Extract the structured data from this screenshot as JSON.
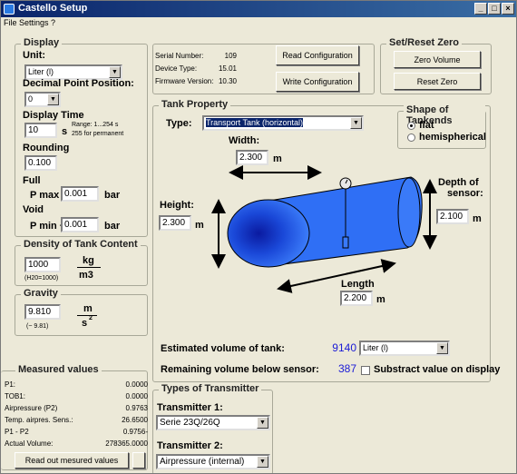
{
  "window": {
    "title": "Castello Setup",
    "min": "_",
    "max": "□",
    "close": "×"
  },
  "menu": [
    "File",
    "Settings",
    "?"
  ],
  "display": {
    "group": "Display",
    "unit_label": "Unit:",
    "unit_value": "Liter (l)",
    "dp_label": "Decimal Point Position:",
    "dp_value": "0",
    "time_label": "Display Time",
    "time_value": "10",
    "time_unit": "s",
    "time_range": "Range: 1...254 s",
    "time_perm": "255 for permanent",
    "rounding_label": "Rounding",
    "rounding_value": "0.100",
    "full_label": "Full",
    "pmax_label": "P max -",
    "pmax_value": "0.001",
    "pmax_unit": "bar",
    "void_label": "Void",
    "pmin_label": "P min +",
    "pmin_value": "0.001",
    "pmin_unit": "bar"
  },
  "density": {
    "group": "Density of Tank Content",
    "value": "1000",
    "unit_num": "kg",
    "unit_den": "m3",
    "note": "(H20=1000)"
  },
  "gravity": {
    "group": "Gravity",
    "value": "9.810",
    "unit_num": "m",
    "unit_den": "s",
    "unit_exp": "2",
    "note": "(~ 9.81)"
  },
  "device": {
    "serial_label": "Serial Number:",
    "serial_value": "109",
    "type_label": "Device Type:",
    "type_value": "15.01",
    "fw_label": "Firmware Version:",
    "fw_value": "10.30",
    "read_btn": "Read Configuration",
    "write_btn": "Write Configuration"
  },
  "zero": {
    "group": "Set/Reset Zero",
    "zero_btn": "Zero Volume",
    "reset_btn": "Reset Zero"
  },
  "tank": {
    "group": "Tank Property",
    "type_label": "Type:",
    "type_value": "Transport Tank (horizontal)",
    "width_label": "Width:",
    "width_value": "2.300",
    "width_unit": "m",
    "height_label": "Height:",
    "height_value": "2.300",
    "height_unit": "m",
    "length_label": "Length",
    "length_value": "2.200",
    "length_unit": "m",
    "depth_label_1": "Depth of",
    "depth_label_2": "sensor:",
    "depth_value": "2.100",
    "depth_unit": "m",
    "est_label": "Estimated volume of tank:",
    "est_value": "9140",
    "est_unit": "Liter (l)",
    "rem_label": "Remaining volume below sensor:",
    "rem_value": "387",
    "subtract_label": "Substract value on display"
  },
  "shape": {
    "group": "Shape of Tankends",
    "opt1": "flat",
    "opt2": "hemispherical",
    "selected": "flat"
  },
  "measured": {
    "group": "Measured values",
    "rows": [
      {
        "k": "P1:",
        "v": "0.0000"
      },
      {
        "k": "TOB1:",
        "v": "0.0000"
      },
      {
        "k": "Airpressure (P2)",
        "v": "0.9763"
      },
      {
        "k": "Temp. airpres. Sens.:",
        "v": "26.6500"
      },
      {
        "k": "P1 - P2",
        "v": "0.9756-"
      },
      {
        "k": "Actual Volume:",
        "v": "278365.0000"
      }
    ],
    "read_btn": "Read out mesured values"
  },
  "transmitter": {
    "group": "Types of Transmitter",
    "t1_label": "Transmitter 1:",
    "t1_value": "Serie 23Q/26Q",
    "t2_label": "Transmitter 2:",
    "t2_value": "Airpressure (internal)"
  },
  "colors": {
    "title_start": "#0a246a",
    "title_end": "#3a6ea5",
    "tank_fill": "#2a6cf0",
    "value_blue": "#1a1ad6",
    "window_bg": "#ece9d8"
  }
}
